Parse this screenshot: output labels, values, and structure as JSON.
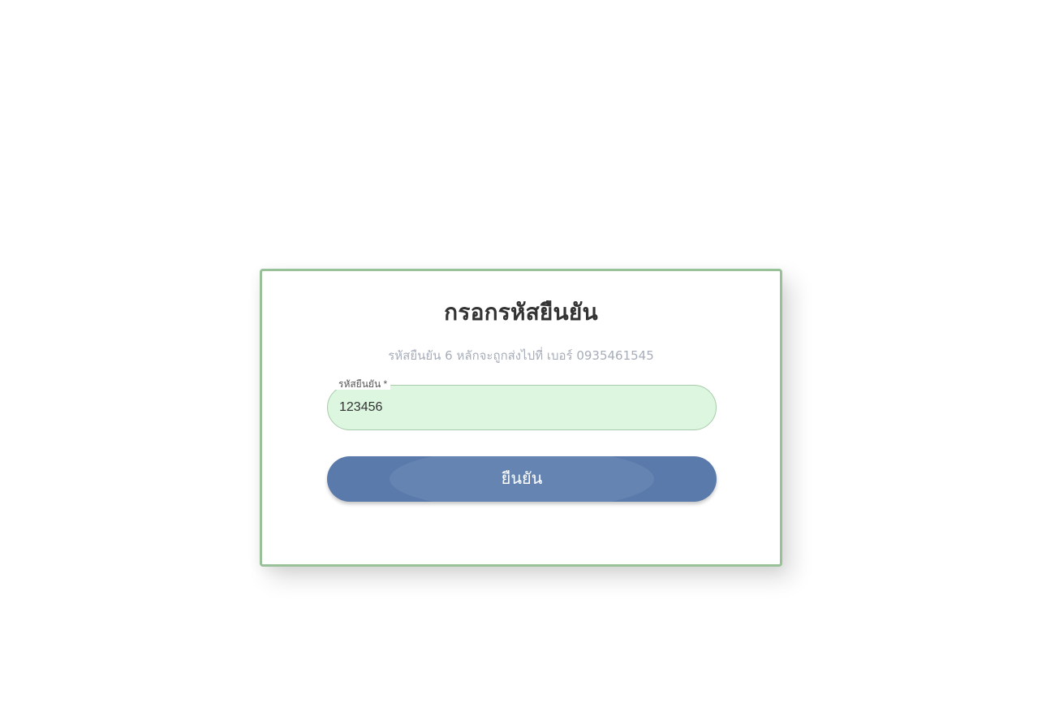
{
  "verify_form": {
    "title": "กรอกรหัสยืนยัน",
    "subtitle": "รหัสยืนยัน 6 หลักจะถูกส่งไปที่ เบอร์ 0935461545",
    "code_field": {
      "label": "รหัสยืนยัน *",
      "value": "123456"
    },
    "submit_label": "ยืนยัน"
  },
  "colors": {
    "card_border": "#98c199",
    "input_background": "#dcf6e0",
    "input_border": "#a8ccab",
    "button_background": "#5a7aab",
    "subtitle_text": "#a7adb9"
  }
}
